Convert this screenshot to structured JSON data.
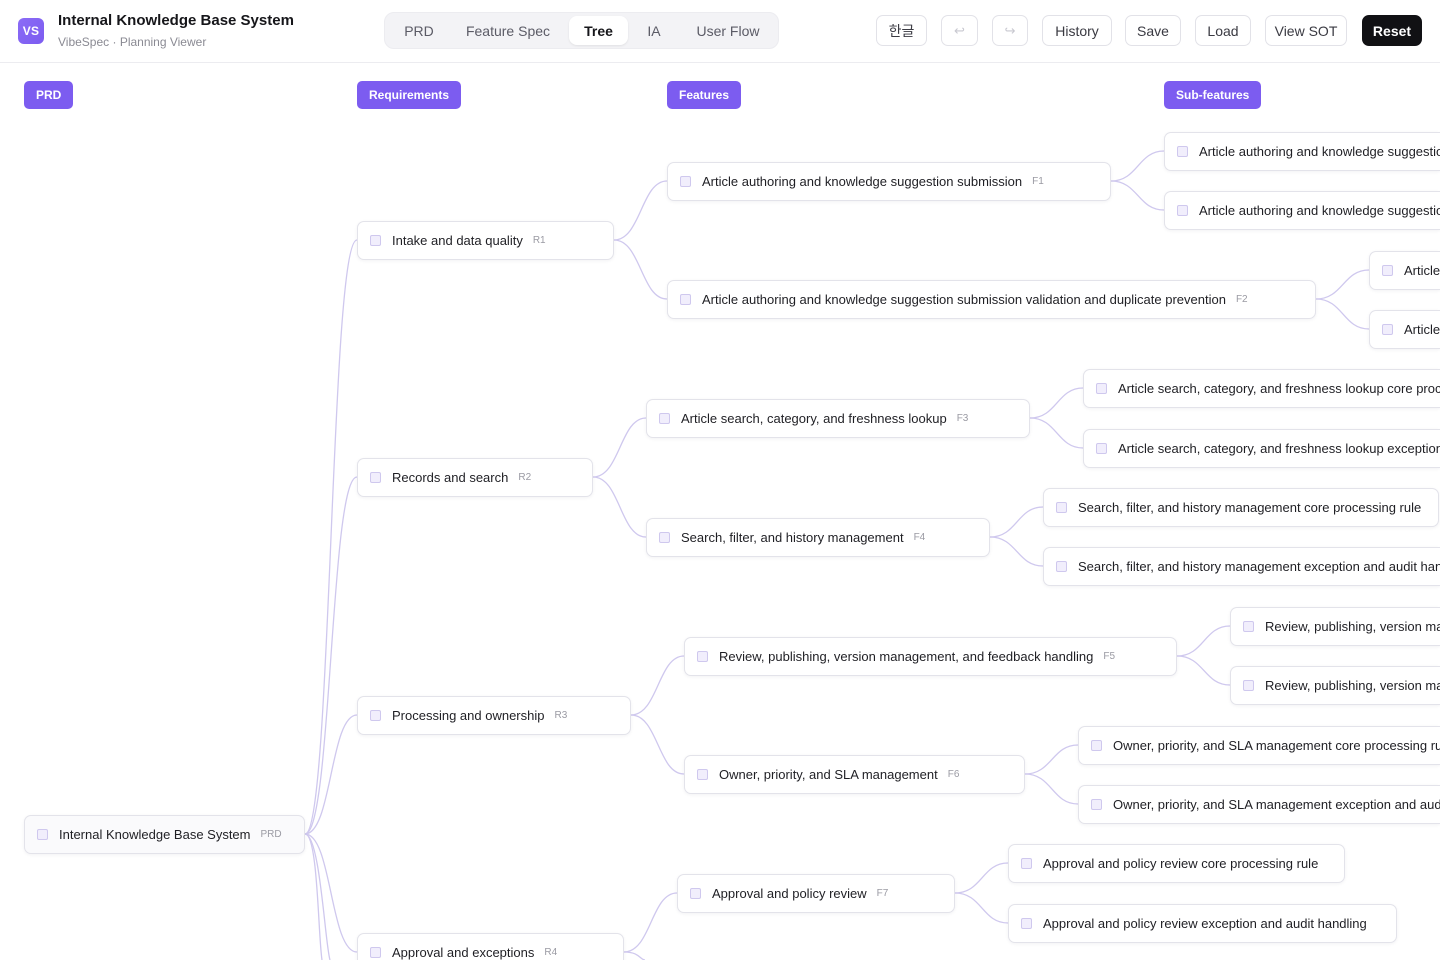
{
  "app": {
    "logo": "VS",
    "title": "Internal Knowledge Base System",
    "subtitle": "VibeSpec · Planning Viewer"
  },
  "tabs": [
    {
      "label": "PRD",
      "active": false
    },
    {
      "label": "Feature Spec",
      "active": false
    },
    {
      "label": "Tree",
      "active": true
    },
    {
      "label": "IA",
      "active": false
    },
    {
      "label": "User Flow",
      "active": false
    }
  ],
  "toolbar": {
    "language": "한글",
    "undo_icon": "↩",
    "redo_icon": "↪",
    "history": "History",
    "save": "Save",
    "load": "Load",
    "view_sot": "View SOT",
    "reset": "Reset"
  },
  "columns": {
    "prd": "PRD",
    "requirements": "Requirements",
    "features": "Features",
    "subfeatures": "Sub-features"
  },
  "colors": {
    "accent": "#7c5cf0",
    "link": "#cfc8ee",
    "dark_button": "#111114"
  },
  "tree": {
    "root": {
      "label": "Internal Knowledge Base System",
      "id": "PRD"
    },
    "requirements": [
      {
        "label": "Intake and data quality",
        "id": "R1"
      },
      {
        "label": "Records and search",
        "id": "R2"
      },
      {
        "label": "Processing and ownership",
        "id": "R3"
      },
      {
        "label": "Approval and exceptions",
        "id": "R4"
      }
    ],
    "features": [
      {
        "label": "Article authoring and knowledge suggestion submission",
        "id": "F1"
      },
      {
        "label": "Article authoring and knowledge suggestion submission validation and duplicate prevention",
        "id": "F2"
      },
      {
        "label": "Article search, category, and freshness lookup",
        "id": "F3"
      },
      {
        "label": "Search, filter, and history management",
        "id": "F4"
      },
      {
        "label": "Review, publishing, version management, and feedback handling",
        "id": "F5"
      },
      {
        "label": "Owner, priority, and SLA management",
        "id": "F6"
      },
      {
        "label": "Approval and policy review",
        "id": "F7"
      }
    ],
    "subfeatures": [
      {
        "label": "Article authoring and knowledge suggestio"
      },
      {
        "label": "Article authoring and knowledge suggestio"
      },
      {
        "label": "Article"
      },
      {
        "label": "Article"
      },
      {
        "label": "Article search, category, and freshness lookup core proce"
      },
      {
        "label": "Article search, category, and freshness lookup exception a"
      },
      {
        "label": "Search, filter, and history management core processing rule"
      },
      {
        "label": "Search, filter, and history management exception and audit hand"
      },
      {
        "label": "Review, publishing, version mar"
      },
      {
        "label": "Review, publishing, version mar"
      },
      {
        "label": "Owner, priority, and SLA management core processing rule"
      },
      {
        "label": "Owner, priority, and SLA management exception and audit"
      },
      {
        "label": "Approval and policy review core processing rule"
      },
      {
        "label": "Approval and policy review exception and audit handling"
      }
    ]
  }
}
